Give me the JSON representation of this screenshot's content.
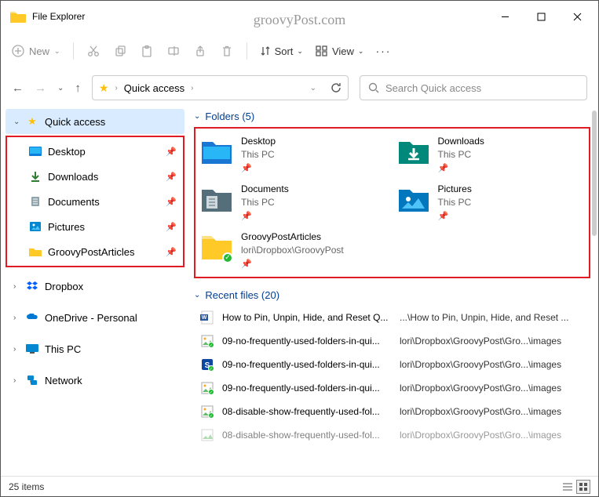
{
  "window": {
    "title": "File Explorer"
  },
  "watermark": "groovyPost.com",
  "toolbar": {
    "new": "New",
    "sort": "Sort",
    "view": "View"
  },
  "breadcrumb": {
    "label": "Quick access"
  },
  "search": {
    "placeholder": "Search Quick access"
  },
  "sidebar": {
    "quick_access": "Quick access",
    "items": [
      {
        "label": "Desktop"
      },
      {
        "label": "Downloads"
      },
      {
        "label": "Documents"
      },
      {
        "label": "Pictures"
      },
      {
        "label": "GroovyPostArticles"
      }
    ],
    "dropbox": "Dropbox",
    "onedrive": "OneDrive - Personal",
    "thispc": "This PC",
    "network": "Network"
  },
  "folders": {
    "header": "Folders (5)",
    "items": [
      {
        "name": "Desktop",
        "path": "This PC"
      },
      {
        "name": "Downloads",
        "path": "This PC"
      },
      {
        "name": "Documents",
        "path": "This PC"
      },
      {
        "name": "Pictures",
        "path": "This PC"
      },
      {
        "name": "GroovyPostArticles",
        "path": "lori\\Dropbox\\GroovyPost"
      }
    ]
  },
  "recent": {
    "header": "Recent files (20)",
    "items": [
      {
        "name": "How to Pin, Unpin, Hide, and Reset Q...",
        "path": "...\\How to Pin, Unpin, Hide, and Reset ..."
      },
      {
        "name": "09-no-frequently-used-folders-in-qui...",
        "path": "lori\\Dropbox\\GroovyPost\\Gro...\\images"
      },
      {
        "name": "09-no-frequently-used-folders-in-qui...",
        "path": "lori\\Dropbox\\GroovyPost\\Gro...\\images"
      },
      {
        "name": "09-no-frequently-used-folders-in-qui...",
        "path": "lori\\Dropbox\\GroovyPost\\Gro...\\images"
      },
      {
        "name": "08-disable-show-frequently-used-fol...",
        "path": "lori\\Dropbox\\GroovyPost\\Gro...\\images"
      },
      {
        "name": "08-disable-show-frequently-used-fol...",
        "path": "lori\\Dropbox\\GroovyPost\\Gro...\\images"
      }
    ]
  },
  "status": {
    "count": "25 items"
  }
}
